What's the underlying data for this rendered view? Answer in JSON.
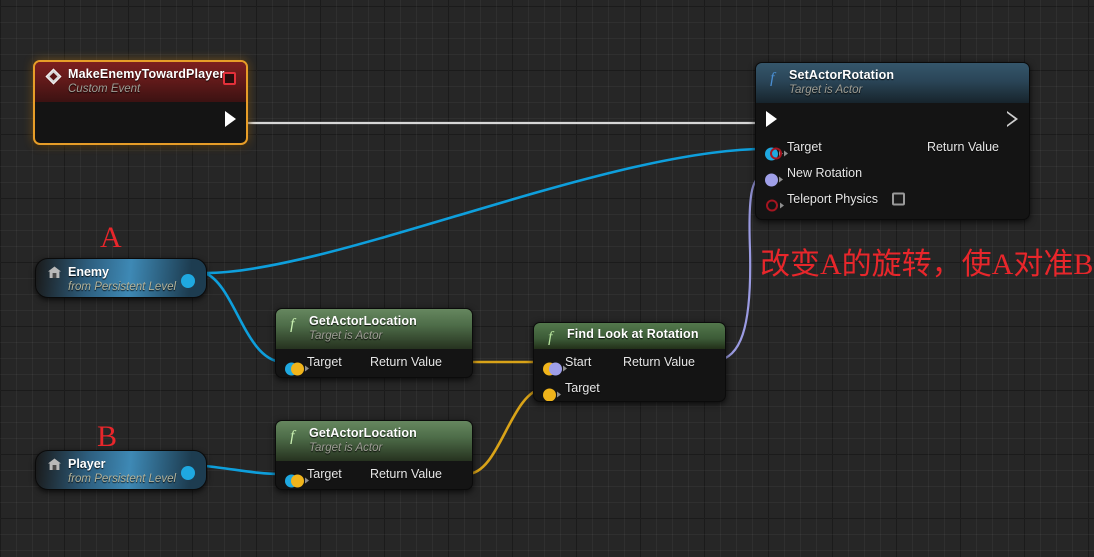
{
  "editor": {
    "name": "unreal-blueprint-graph"
  },
  "nodes": {
    "custom_event": {
      "title": "MakeEnemyTowardPlayer",
      "subtitle": "Custom Event",
      "icon": "event-diamond-icon",
      "selected": true,
      "exec_out": "exec-output-pin",
      "delegate_pin": "delegate-output-pin"
    },
    "set_actor_rotation": {
      "title": "SetActorRotation",
      "subtitle": "Target is Actor",
      "icon": "function-f-icon",
      "pins_in": [
        {
          "label": "Target",
          "type": "object",
          "color": "#1fa8e0"
        },
        {
          "label": "New Rotation",
          "type": "rotator",
          "color": "#9f9fe8"
        },
        {
          "label": "Teleport Physics",
          "type": "boolean",
          "color": "#a41520",
          "checkbox": false
        }
      ],
      "pins_out": [
        {
          "label": "Return Value",
          "type": "boolean",
          "color": "#a41520"
        }
      ]
    },
    "find_look_at_rotation": {
      "title": "Find Look at Rotation",
      "subtitle": "",
      "icon": "function-f-icon",
      "pins_in": [
        {
          "label": "Start",
          "type": "vector",
          "color": "#f0b41b"
        },
        {
          "label": "Target",
          "type": "vector",
          "color": "#f0b41b"
        }
      ],
      "pins_out": [
        {
          "label": "Return Value",
          "type": "rotator",
          "color": "#9f9fe8"
        }
      ]
    },
    "get_actor_location_enemy": {
      "title": "GetActorLocation",
      "subtitle": "Target is Actor",
      "icon": "function-f-icon",
      "pins_in": [
        {
          "label": "Target",
          "type": "object",
          "color": "#1fa8e0"
        }
      ],
      "pins_out": [
        {
          "label": "Return Value",
          "type": "vector",
          "color": "#f0b41b"
        }
      ]
    },
    "get_actor_location_player": {
      "title": "GetActorLocation",
      "subtitle": "Target is Actor",
      "icon": "function-f-icon",
      "pins_in": [
        {
          "label": "Target",
          "type": "object",
          "color": "#1fa8e0"
        }
      ],
      "pins_out": [
        {
          "label": "Return Value",
          "type": "vector",
          "color": "#f0b41b"
        }
      ]
    },
    "enemy_ref": {
      "title": "Enemy",
      "subtitle": "from Persistent Level",
      "icon": "level-actor-house-icon"
    },
    "player_ref": {
      "title": "Player",
      "subtitle": "from Persistent Level",
      "icon": "level-actor-house-icon"
    }
  },
  "annotations": {
    "label_a": "A",
    "label_b": "B",
    "comment": "改变A的旋转，使A对准B",
    "color": "#e8262b"
  },
  "colors": {
    "exec_wire": "#d7d7d7",
    "object_wire": "#0e9fdc",
    "vector_wire": "#d9a318",
    "rotator_wire": "#9b9be2",
    "selection": "#e79d28",
    "canvas_bg": "#262626"
  }
}
